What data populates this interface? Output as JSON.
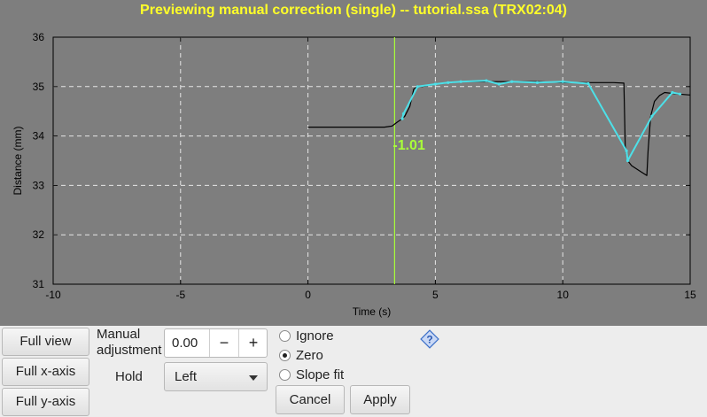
{
  "plot": {
    "title": "Previewing manual correction (single) -- tutorial.ssa (TRX02:04)",
    "annotation_value": "-1.01",
    "colors": {
      "background": "#7e7e7e",
      "frame_bg": "#7e7e7e",
      "title": "#ffff29",
      "trace": "#000000",
      "highlight": "#4de0e8",
      "marker": "#a9ff39"
    }
  },
  "chart_data": {
    "type": "line",
    "xlabel": "Time (s)",
    "ylabel": "Distance (mm)",
    "xlim": [
      -10,
      15
    ],
    "ylim": [
      31,
      36
    ],
    "x_ticks": [
      -10,
      -5,
      0,
      5,
      10,
      15
    ],
    "y_ticks": [
      31,
      32,
      33,
      34,
      35,
      36
    ],
    "grid": true,
    "marker_x": 3.4,
    "series": [
      {
        "color": "#000000",
        "x": [
          0,
          3.0,
          3.3,
          3.5,
          3.7,
          3.8,
          4.0,
          4.15,
          4.3,
          4.5,
          5.0,
          6.0,
          7.0,
          8.0,
          9.0,
          10.0,
          11.0,
          12.0,
          12.4,
          12.45,
          12.55,
          12.7,
          13.0,
          13.3,
          13.35,
          13.45,
          13.6,
          13.8,
          14.0,
          14.5,
          15.0
        ],
        "y": [
          34.18,
          34.18,
          34.2,
          34.28,
          34.35,
          34.4,
          34.6,
          34.95,
          35.0,
          35.0,
          35.05,
          35.1,
          35.1,
          35.1,
          35.1,
          35.08,
          35.08,
          35.08,
          35.07,
          33.8,
          33.5,
          33.4,
          33.3,
          33.2,
          33.7,
          34.4,
          34.7,
          34.82,
          34.88,
          34.85,
          34.83
        ]
      },
      {
        "color": "#4de0e8",
        "x": [
          3.7,
          3.75,
          4.3,
          5.0,
          5.5,
          6.0,
          7.0,
          7.5,
          8.0,
          9.0,
          10.0,
          11.0,
          12.5,
          12.55,
          13.5,
          14.3,
          14.6
        ],
        "y": [
          34.35,
          34.45,
          35.0,
          35.05,
          35.08,
          35.1,
          35.12,
          35.05,
          35.1,
          35.08,
          35.1,
          35.06,
          33.7,
          33.5,
          34.4,
          34.88,
          34.85
        ]
      }
    ]
  },
  "controls": {
    "full_view": "Full view",
    "full_x": "Full x-axis",
    "full_y": "Full y-axis",
    "manual_adjustment": "Manual adjustment",
    "manual_value": "0.00",
    "minus": "−",
    "plus": "+",
    "hold_label": "Hold",
    "hold_value": "Left",
    "radio_ignore": "Ignore",
    "radio_zero": "Zero",
    "radio_slope": "Slope fit",
    "selected_mode": "Zero",
    "cancel": "Cancel",
    "apply": "Apply",
    "help_icon": "help-icon"
  }
}
